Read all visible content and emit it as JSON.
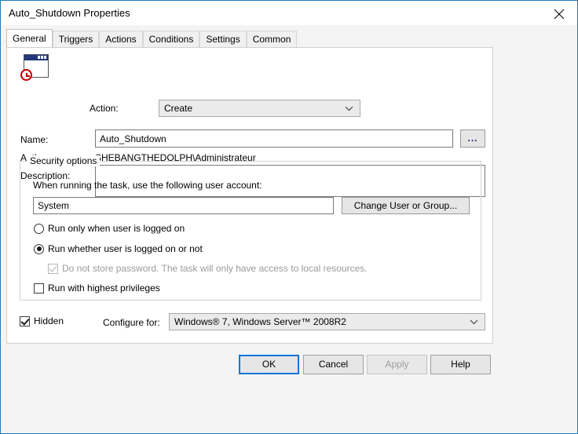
{
  "window": {
    "title": "Auto_Shutdown Properties",
    "close_icon": "close-icon",
    "accent_color": "#1f7cc0"
  },
  "tabs": [
    {
      "label": "General",
      "active": true
    },
    {
      "label": "Triggers",
      "active": false
    },
    {
      "label": "Actions",
      "active": false
    },
    {
      "label": "Conditions",
      "active": false
    },
    {
      "label": "Settings",
      "active": false
    },
    {
      "label": "Common",
      "active": false
    }
  ],
  "general": {
    "action_label": "Action:",
    "action_value": "Create",
    "name_label": "Name:",
    "name_value": "Auto_Shutdown",
    "browse_button": "...",
    "author_label": "Author:",
    "author_value": "SHEBANGTHEDOLPH\\Administrateur",
    "description_label": "Description:",
    "description_value": "",
    "description_placeholder": ""
  },
  "security": {
    "legend": "Security options",
    "account_prompt": "When running the task, use the following user account:",
    "account_value": "System",
    "change_user_button": "Change User or Group...",
    "radio_logged_on": "Run only when user is logged on",
    "radio_whether": "Run whether user is logged on or not",
    "radio_selected": "whether",
    "no_store_password": "Do not store password. The task will only have access to local resources.",
    "no_store_password_checked": true,
    "no_store_password_enabled": false,
    "highest_privileges": "Run with highest privileges",
    "highest_privileges_checked": false
  },
  "footer_options": {
    "hidden_label": "Hidden",
    "hidden_checked": true,
    "configure_for_label": "Configure for:",
    "configure_for_value": "Windows® 7, Windows Server™ 2008R2"
  },
  "buttons": {
    "ok": "OK",
    "cancel": "Cancel",
    "apply": "Apply",
    "help": "Help",
    "apply_enabled": false,
    "default_button": "ok"
  }
}
